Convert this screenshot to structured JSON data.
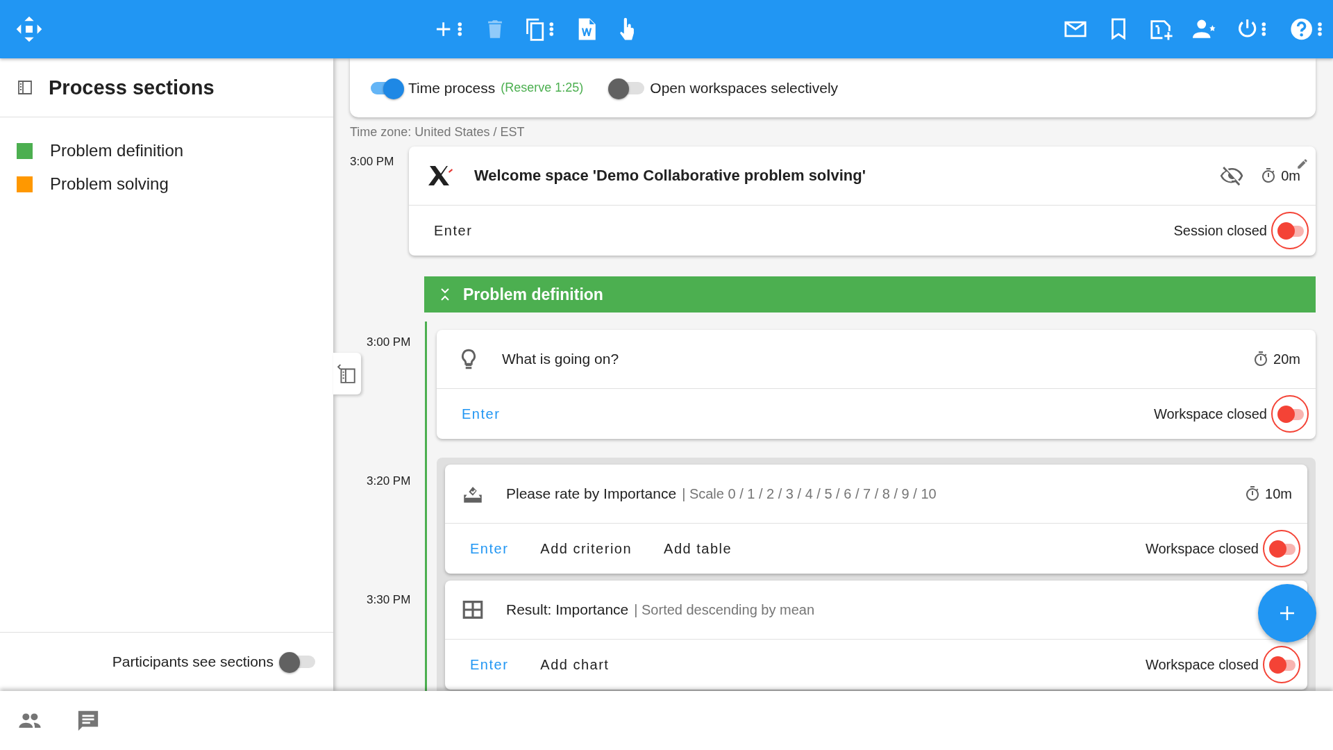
{
  "sidebar": {
    "title": "Process sections",
    "sections": [
      {
        "label": "Problem definition",
        "color": "#4caf50"
      },
      {
        "label": "Problem solving",
        "color": "#ff9800"
      }
    ],
    "participants_toggle": {
      "label": "Participants see sections",
      "on": false
    }
  },
  "controls": [
    {
      "label": "Time process",
      "note": "(Reserve 1:25)",
      "on": true
    },
    {
      "label": "Open workspaces selectively",
      "on": false
    }
  ],
  "timezone": "Time zone: United States / EST",
  "timeline": [
    {
      "kind": "space",
      "time": "3:00 PM",
      "title": "Welcome space 'Demo Collaborative problem solving'",
      "visible": false,
      "duration": "0m",
      "actions": [
        {
          "label": "Enter",
          "link": false
        }
      ],
      "status": "Session closed",
      "open": false
    },
    {
      "kind": "section",
      "title": "Problem definition",
      "color": "#4caf50",
      "children": [
        {
          "kind": "brainstorm",
          "time": "3:00 PM",
          "title": "What is going on?",
          "duration": "20m",
          "actions": [
            {
              "label": "Enter",
              "link": true
            }
          ],
          "status": "Workspace closed",
          "open": false
        },
        {
          "kind": "group",
          "children": [
            {
              "kind": "rating",
              "time": "3:20 PM",
              "title": "Please rate by Importance",
              "detail": "| Scale 0 / 1 / 2 / 3 / 4 / 5 / 6 / 7 / 8 / 9 / 10",
              "duration": "10m",
              "actions": [
                {
                  "label": "Enter",
                  "link": true
                },
                {
                  "label": "Add criterion",
                  "link": false
                },
                {
                  "label": "Add table",
                  "link": false
                }
              ],
              "status": "Workspace closed",
              "open": false
            },
            {
              "kind": "result",
              "time": "3:30 PM",
              "title": "Result: Importance",
              "detail": "| Sorted descending by mean",
              "actions": [
                {
                  "label": "Enter",
                  "link": true
                },
                {
                  "label": "Add chart",
                  "link": false
                }
              ],
              "status": "Workspace closed",
              "open": false
            }
          ]
        }
      ]
    }
  ]
}
